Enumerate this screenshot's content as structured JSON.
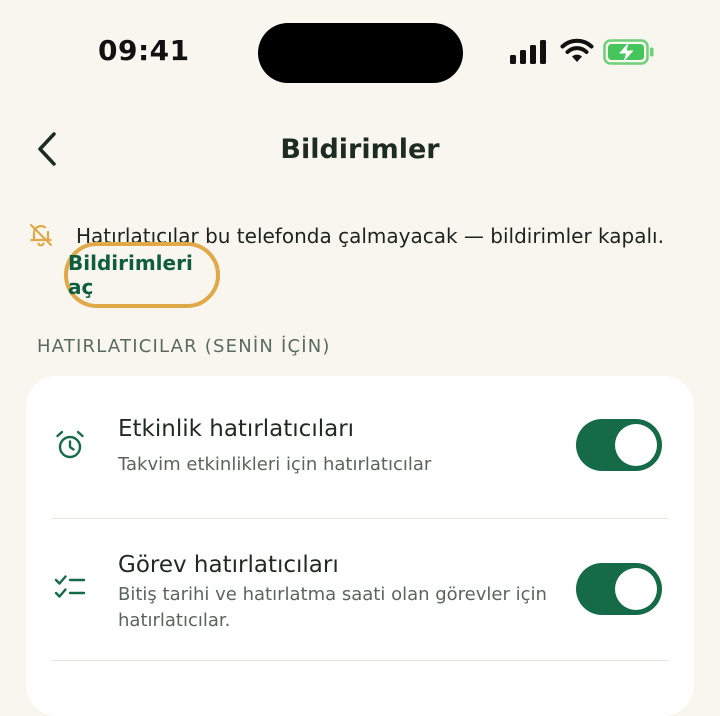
{
  "status_bar": {
    "time": "09:41"
  },
  "header": {
    "title": "Bildirimler",
    "back_icon": "chevron-left-icon"
  },
  "banner": {
    "icon": "bell-off-icon",
    "message": "Hatırlatıcılar bu telefonda çalmayacak — bildirimler kapalı.",
    "action_label": "Bildirimleri aç",
    "accent_color": "#e1a84a"
  },
  "section": {
    "label": "HATIRLATICILAR (SENİN İÇİN)",
    "items": [
      {
        "icon": "alarm-clock-icon",
        "title": "Etkinlik hatırlatıcıları",
        "subtitle": "Takvim etkinlikleri için hatırlatıcılar",
        "enabled": true
      },
      {
        "icon": "checklist-icon",
        "title": "Görev hatırlatıcıları",
        "subtitle": "Bitiş tarihi ve hatırlatma saati olan görevler için hatırlatıcılar.",
        "enabled": true
      }
    ]
  },
  "colors": {
    "brand": "#156b47",
    "background": "#f8f6ee"
  }
}
